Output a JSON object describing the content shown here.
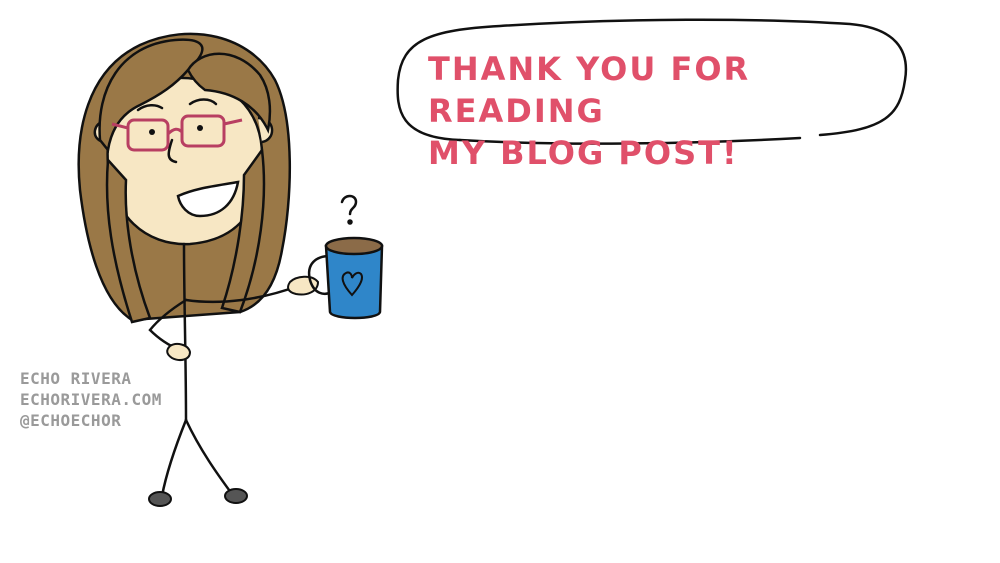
{
  "speech_bubble": {
    "line1": "THANK YOU FOR READING",
    "line2": "MY BLOG POST!"
  },
  "signature": {
    "name": "ECHO RIVERA",
    "website": "ECHORIVERA.COM",
    "handle": "@ECHOECHOR"
  },
  "colors": {
    "hair": "#9a7847",
    "skin": "#f7e7c4",
    "glasses": "#b83f62",
    "mug": "#2f86c9",
    "coffee": "#8b6b48",
    "text_accent": "#e0506a",
    "signature_text": "#9a9a9a",
    "shoes": "#555555"
  },
  "icons": {
    "mug_decoration": "heart-icon",
    "steam": "question-mark-steam"
  }
}
